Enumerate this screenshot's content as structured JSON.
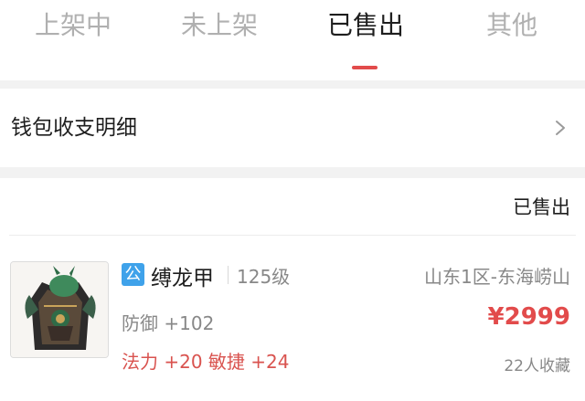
{
  "tabs": [
    {
      "label": "上架中"
    },
    {
      "label": "未上架"
    },
    {
      "label": "已售出"
    },
    {
      "label": "其他"
    }
  ],
  "active_tab_index": 2,
  "wallet": {
    "label": "钱包收支明细",
    "icon": "chevron-right-icon"
  },
  "list": {
    "status_label": "已售出"
  },
  "item": {
    "badge": "公",
    "name": "缚龙甲",
    "level": "125级",
    "server": "山东1区-东海崂山",
    "defense": "防御 +102",
    "price": "¥2999",
    "bonus": "法力 +20 敏捷 +24",
    "favorites": "22人收藏",
    "image_icon": "dragon-armor-icon"
  },
  "colors": {
    "accent": "#e24b4b",
    "badge": "#3fa2ea",
    "muted_text": "#888888",
    "inactive_tab": "#b0b0b0"
  }
}
